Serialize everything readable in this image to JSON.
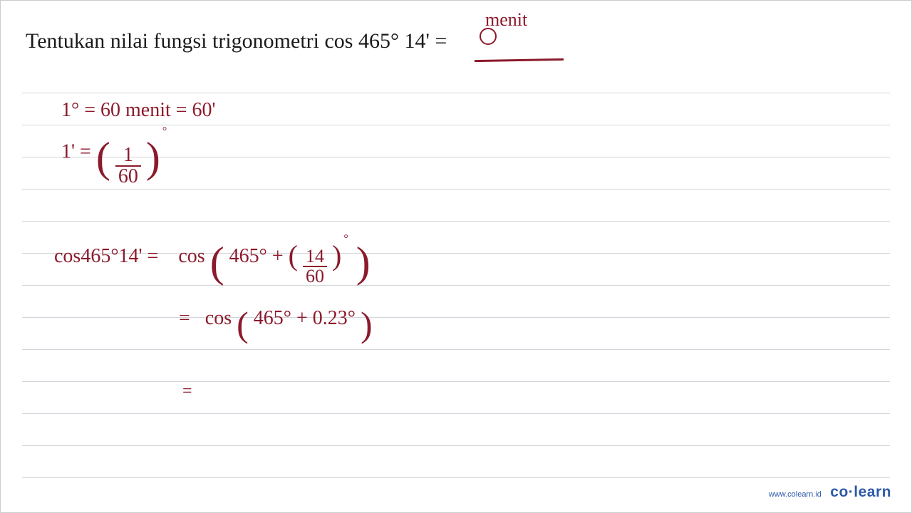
{
  "problem": {
    "text": "Tentukan nilai fungsi trigonometri cos 465° 14' ="
  },
  "annotations": {
    "menit_label": "menit"
  },
  "work": {
    "line1": "1° = 60 menit = 60'",
    "line2_lhs": "1' =",
    "line2_frac_num": "1",
    "line2_frac_den": "60",
    "line2_deg": "°",
    "line3_lhs": "cos465°14' =",
    "line3_cos": "cos",
    "line3_a": "465° +",
    "line3_frac_num": "14",
    "line3_frac_den": "60",
    "line3_deg": "°",
    "line4_eq": "=",
    "line4_cos": "cos",
    "line4_expr": "465° + 0.23°",
    "line5_eq": "="
  },
  "footer": {
    "url": "www.colearn.id",
    "brand": "co·learn"
  }
}
